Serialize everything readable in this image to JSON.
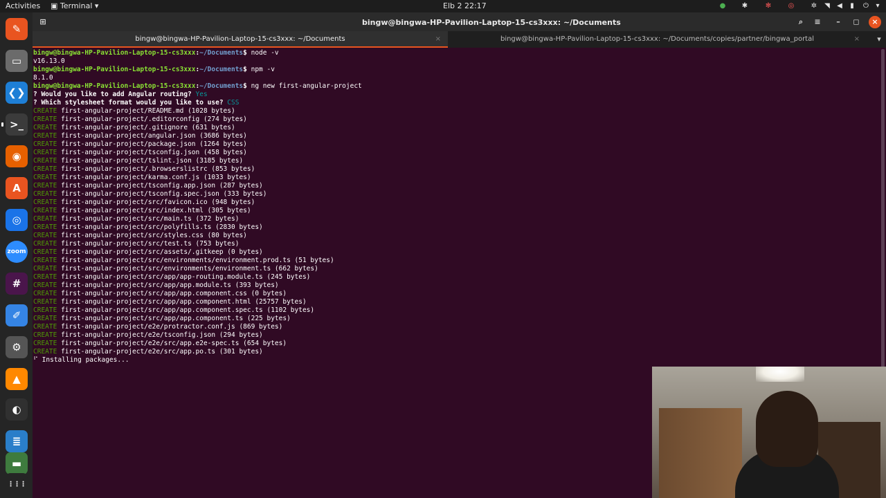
{
  "topbar": {
    "activities": "Activities",
    "app_menu": "Terminal",
    "clock": "Elb 2  22:17"
  },
  "window": {
    "title": "bingw@bingwa-HP-Pavilion-Laptop-15-cs3xxx: ~/Documents"
  },
  "tabs": [
    {
      "label": "bingw@bingwa-HP-Pavilion-Laptop-15-cs3xxx: ~/Documents",
      "active": true
    },
    {
      "label": "bingw@bingwa-HP-Pavilion-Laptop-15-cs3xxx: ~/Documents/copies/partner/bingwa_portal",
      "active": false
    }
  ],
  "dock": [
    {
      "name": "pen-app-icon",
      "color": "#e95420",
      "glyph": "✎"
    },
    {
      "name": "files-icon",
      "color": "#6b6b6b",
      "glyph": "▭"
    },
    {
      "name": "vscode-icon",
      "color": "#1e7fd6",
      "glyph": "❮❯"
    },
    {
      "name": "terminal-icon",
      "color": "#3b3b3b",
      "glyph": ">_"
    },
    {
      "name": "firefox-icon",
      "color": "#e66000",
      "glyph": "◉"
    },
    {
      "name": "app-center-icon",
      "color": "#e95420",
      "glyph": "A"
    },
    {
      "name": "chrome-icon",
      "color": "#1a73e8",
      "glyph": "◎"
    },
    {
      "name": "zoom-icon",
      "color": "#2d8cff",
      "glyph": "zoom"
    },
    {
      "name": "slack-icon",
      "color": "#4a154b",
      "glyph": "#"
    },
    {
      "name": "text-editor-icon",
      "color": "#3584e4",
      "glyph": "✐"
    },
    {
      "name": "settings-icon",
      "color": "#555555",
      "glyph": "⚙"
    },
    {
      "name": "vlc-icon",
      "color": "#ff8800",
      "glyph": "▲"
    },
    {
      "name": "obs-icon",
      "color": "#303030",
      "glyph": "◐"
    },
    {
      "name": "writer-icon",
      "color": "#2a7ec9",
      "glyph": "≣"
    },
    {
      "name": "disk-icon",
      "color": "#3e7b3e",
      "glyph": "▬"
    },
    {
      "name": "show-apps-icon",
      "color": "#252525",
      "glyph": "⋮⋮⋮"
    }
  ],
  "terminal": {
    "prompt_user": "bingw@bingwa-HP-Pavilion-Laptop-15-cs3xxx",
    "prompt_path": "~/Documents",
    "cmd_node": "node -v",
    "out_node": "v16.13.0",
    "cmd_npm": "npm -v",
    "out_npm": "8.1.0",
    "cmd_ng": "ng new first-angular-project",
    "q_routing": "? Would you like to add Angular routing?",
    "a_routing": "Yes",
    "q_style": "? Which stylesheet format would you like to use?",
    "a_style": "CSS",
    "create_label": "CREATE",
    "creates": [
      "first-angular-project/README.md (1028 bytes)",
      "first-angular-project/.editorconfig (274 bytes)",
      "first-angular-project/.gitignore (631 bytes)",
      "first-angular-project/angular.json (3686 bytes)",
      "first-angular-project/package.json (1264 bytes)",
      "first-angular-project/tsconfig.json (458 bytes)",
      "first-angular-project/tslint.json (3185 bytes)",
      "first-angular-project/.browserslistrc (853 bytes)",
      "first-angular-project/karma.conf.js (1033 bytes)",
      "first-angular-project/tsconfig.app.json (287 bytes)",
      "first-angular-project/tsconfig.spec.json (333 bytes)",
      "first-angular-project/src/favicon.ico (948 bytes)",
      "first-angular-project/src/index.html (305 bytes)",
      "first-angular-project/src/main.ts (372 bytes)",
      "first-angular-project/src/polyfills.ts (2830 bytes)",
      "first-angular-project/src/styles.css (80 bytes)",
      "first-angular-project/src/test.ts (753 bytes)",
      "first-angular-project/src/assets/.gitkeep (0 bytes)",
      "first-angular-project/src/environments/environment.prod.ts (51 bytes)",
      "first-angular-project/src/environments/environment.ts (662 bytes)",
      "first-angular-project/src/app/app-routing.module.ts (245 bytes)",
      "first-angular-project/src/app/app.module.ts (393 bytes)",
      "first-angular-project/src/app/app.component.css (0 bytes)",
      "first-angular-project/src/app/app.component.html (25757 bytes)",
      "first-angular-project/src/app/app.component.spec.ts (1102 bytes)",
      "first-angular-project/src/app/app.component.ts (225 bytes)",
      "first-angular-project/e2e/protractor.conf.js (869 bytes)",
      "first-angular-project/e2e/tsconfig.json (294 bytes)",
      "first-angular-project/e2e/src/app.e2e-spec.ts (654 bytes)",
      "first-angular-project/e2e/src/app.po.ts (301 bytes)"
    ],
    "installing": "⠋ Installing packages..."
  }
}
